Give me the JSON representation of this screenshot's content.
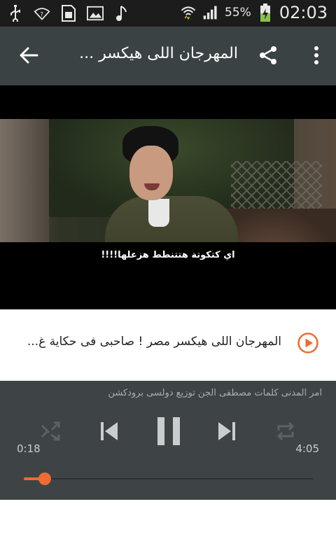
{
  "status_bar": {
    "icons_left": [
      "usb-icon",
      "wifi-question-icon",
      "sim-card-icon",
      "image-icon",
      "music-note-icon"
    ],
    "icons_right": [
      "wifi-icon",
      "signal-icon",
      "battery-charging-icon"
    ],
    "battery": "55%",
    "time": "02:03"
  },
  "toolbar": {
    "title": "المهرجان اللى هيكسر ...",
    "back_icon": "arrow-back-icon",
    "share_icon": "share-icon",
    "more_icon": "more-vert-icon"
  },
  "video": {
    "subtitle": "اي كتكوتة هتتنطط هزعلها!!!!"
  },
  "track": {
    "title": "المهرجان اللى هيكسر مصر ! صاحبى فى حكاية غ...",
    "play_icon": "play-circle-icon",
    "accent": "#ee6b33"
  },
  "player": {
    "marquee": "امر المدنى كلمات مصطفى الجن  توزيع دولسى برودكشن",
    "current_time": "0:18",
    "total_time": "4:05",
    "progress": 0.073,
    "controls": [
      "shuffle-icon",
      "skip-previous-icon",
      "pause-icon",
      "skip-next-icon",
      "repeat-icon"
    ],
    "accent": "#ee6b33"
  }
}
